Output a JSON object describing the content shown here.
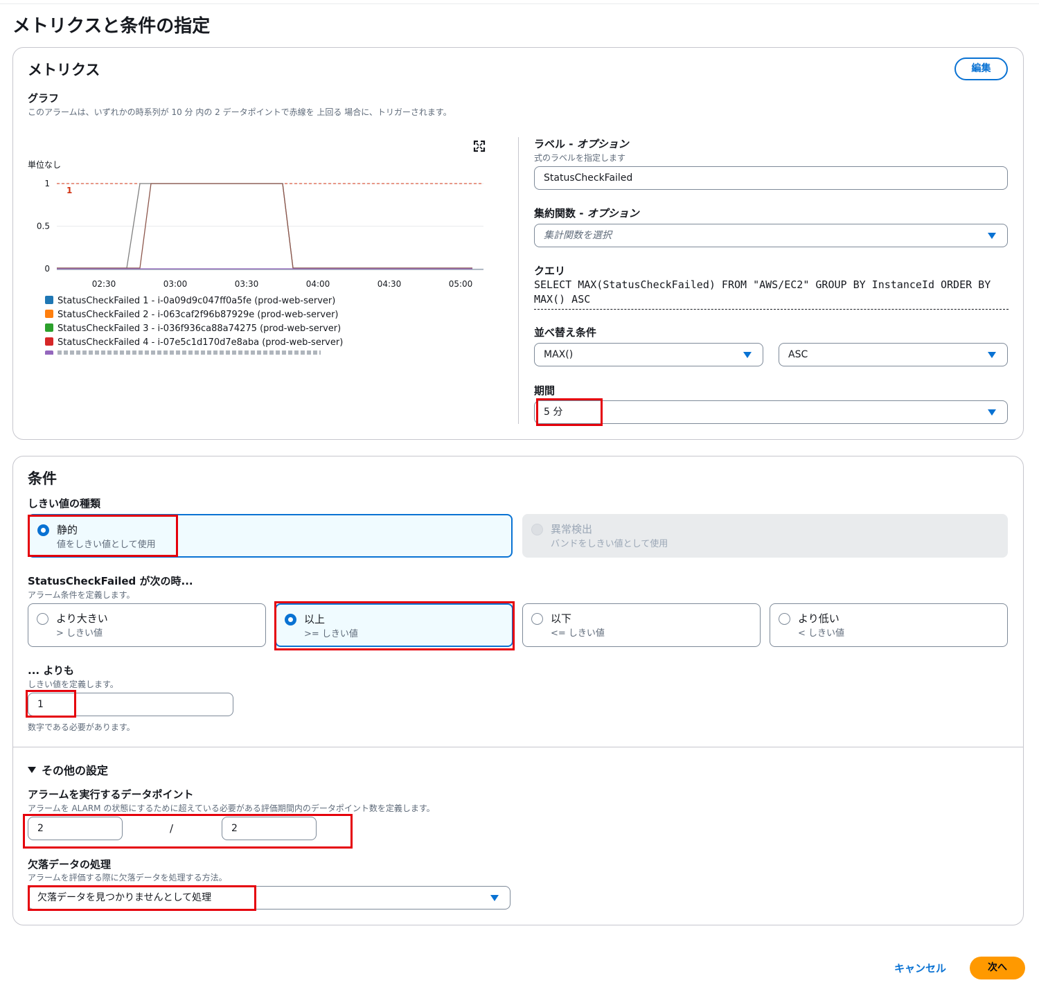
{
  "page": {
    "title": "メトリクスと条件の指定"
  },
  "metrics": {
    "heading": "メトリクス",
    "edit_label": "編集",
    "graph_label": "グラフ",
    "graph_desc": "このアラームは、いずれかの時系列が 10 分 内の 2 データポイントで赤線を 上回る 場合に、トリガーされます。",
    "unit_label": "単位なし",
    "threshold_label": "1",
    "expand_icon": "expand-icon",
    "label_field": {
      "label_prefix": "ラベル - ",
      "label_optional": "オプション",
      "desc": "式のラベルを指定します",
      "value": "StatusCheckFailed"
    },
    "aggregate_field": {
      "label_prefix": "集約関数 - ",
      "label_optional": "オプション",
      "placeholder": "集計関数を選択"
    },
    "query": {
      "label": "クエリ",
      "value": "SELECT MAX(StatusCheckFailed) FROM \"AWS/EC2\" GROUP BY InstanceId ORDER BY MAX() ASC"
    },
    "order": {
      "label": "並べ替え条件",
      "func_value": "MAX()",
      "dir_value": "ASC"
    },
    "period": {
      "label": "期間",
      "value": "5 分"
    }
  },
  "chart_data": {
    "type": "line",
    "ylabel": "単位なし",
    "yticks": [
      "0",
      "0.5",
      "1"
    ],
    "ylim": [
      0,
      1
    ],
    "x": [
      "02:30",
      "03:00",
      "03:30",
      "04:00",
      "04:30",
      "05:00"
    ],
    "threshold": 1,
    "series": [
      {
        "name": "StatusCheckFailed 1 - i-0a09d9c047ff0a5fe (prod-web-server)",
        "color": "#1f77b4"
      },
      {
        "name": "StatusCheckFailed 2 - i-063caf2f96b87929e (prod-web-server)",
        "color": "#ff7f0e"
      },
      {
        "name": "StatusCheckFailed 3 - i-036f936ca88a74275 (prod-web-server)",
        "color": "#2ca02c"
      },
      {
        "name": "StatusCheckFailed 4 - i-07e5c1d170d7e8aba (prod-web-server)",
        "color": "#d62728"
      }
    ],
    "legend_position": "bottom",
    "grid": true
  },
  "conditions": {
    "heading": "条件",
    "threshold_type": {
      "label": "しきい値の種類",
      "static": {
        "title": "静的",
        "sub": "値をしきい値として使用"
      },
      "anomaly": {
        "title": "異常検出",
        "sub": "バンドをしきい値として使用"
      }
    },
    "when": {
      "label": "StatusCheckFailed が次の時...",
      "desc": "アラーム条件を定義します。",
      "options": [
        {
          "title": "より大きい",
          "sub": "> しきい値"
        },
        {
          "title": "以上",
          "sub": ">= しきい値"
        },
        {
          "title": "以下",
          "sub": "<= しきい値"
        },
        {
          "title": "より低い",
          "sub": "< しきい値"
        }
      ]
    },
    "than": {
      "label": "... よりも",
      "desc": "しきい値を定義します。",
      "value": "1",
      "hint": "数字である必要があります。"
    },
    "other": {
      "toggle": "その他の設定",
      "datapoints": {
        "label": "アラームを実行するデータポイント",
        "desc": "アラームを ALARM の状態にするために超えている必要がある評価期間内のデータポイント数を定義します。",
        "value1": "2",
        "sep": "/",
        "value2": "2"
      },
      "missing": {
        "label": "欠落データの処理",
        "desc": "アラームを評価する際に欠落データを処理する方法。",
        "value": "欠落データを見つかりませんとして処理"
      }
    }
  },
  "footer": {
    "cancel": "キャンセル",
    "next": "次へ"
  }
}
